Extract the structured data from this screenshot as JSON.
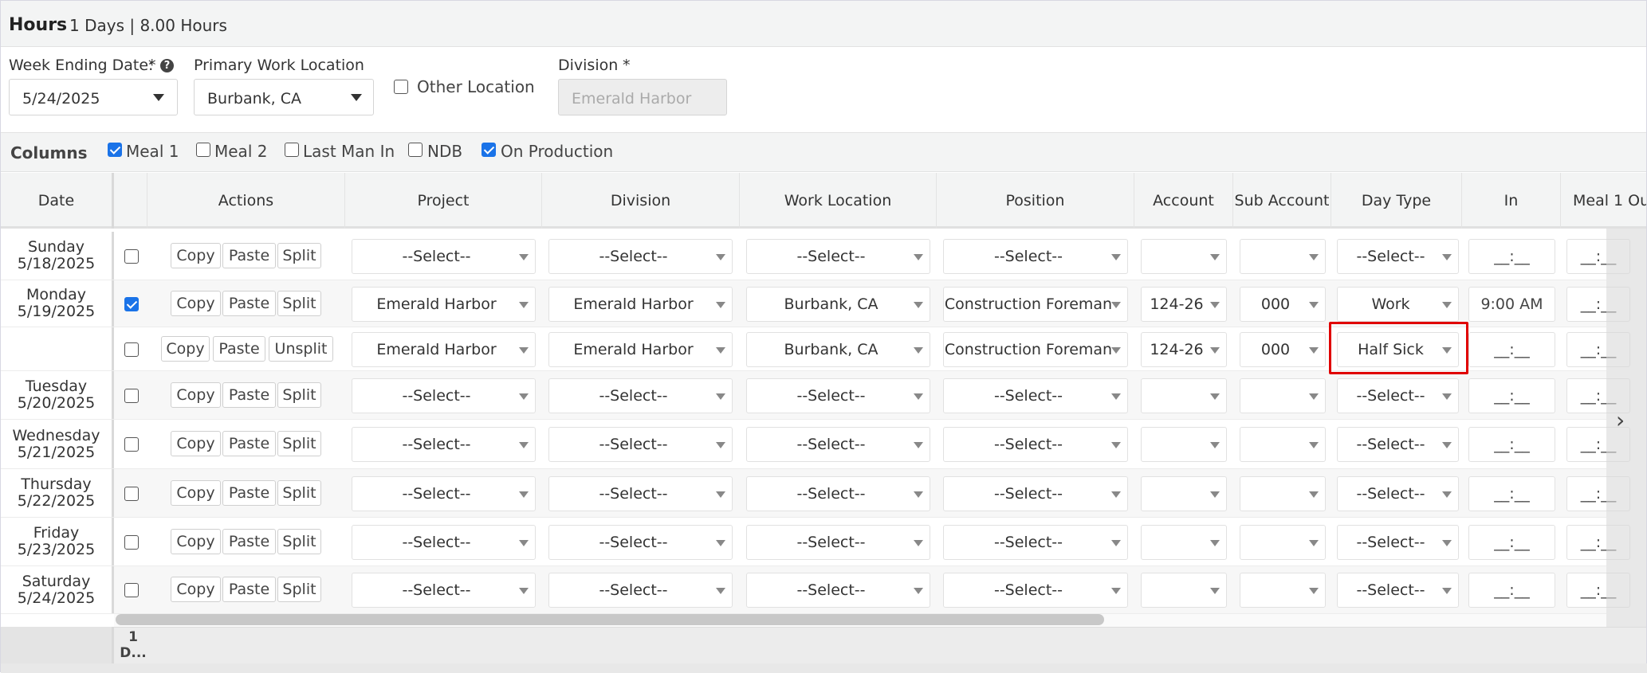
{
  "header": {
    "title": "Hours",
    "summary": "1 Days | 8.00 Hours"
  },
  "form": {
    "week_ending": {
      "label": "Week Ending Date:",
      "required": "*",
      "value": "5/24/2025"
    },
    "primary_location": {
      "label": "Primary Work Location",
      "value": "Burbank, CA"
    },
    "other_location": {
      "label": "Other Location",
      "checked": false
    },
    "division": {
      "label": "Division",
      "required": "*",
      "placeholder": "Emerald Harbor"
    }
  },
  "columns_bar": {
    "title": "Columns",
    "options": [
      {
        "label": "Meal 1",
        "checked": true
      },
      {
        "label": "Meal 2",
        "checked": false
      },
      {
        "label": "Last Man In",
        "checked": false
      },
      {
        "label": "NDB",
        "checked": false
      },
      {
        "label": "On Production",
        "checked": true
      }
    ]
  },
  "grid": {
    "headers": [
      "Date",
      "",
      "Actions",
      "Project",
      "Division",
      "Work Location",
      "Position",
      "Account",
      "Sub Account",
      "Day Type",
      "In",
      "Meal 1 Ou"
    ],
    "buttons": {
      "copy": "Copy",
      "paste": "Paste",
      "split": "Split",
      "unsplit": "Unsplit"
    },
    "rows": [
      {
        "day": "Sunday",
        "date": "5/18/2025",
        "checked": false,
        "project": "--Select--",
        "division": "--Select--",
        "location": "--Select--",
        "position": "--Select--",
        "account": "",
        "sub_account": "",
        "day_type": "--Select--",
        "in": "__:__",
        "meal1_out": "__:__"
      },
      {
        "day": "Monday",
        "date": "5/19/2025",
        "checked": true,
        "project": "Emerald Harbor",
        "division": "Emerald Harbor",
        "location": "Burbank, CA",
        "position": "Construction Foreman",
        "account": "124-26",
        "sub_account": "000",
        "day_type": "Work",
        "in": "9:00 AM",
        "meal1_out": "__:__"
      },
      {
        "day": "",
        "date": "",
        "checked": false,
        "project": "Emerald Harbor",
        "division": "Emerald Harbor",
        "location": "Burbank, CA",
        "position": "Construction Foreman",
        "account": "124-26",
        "sub_account": "000",
        "day_type": "Half Sick",
        "in": "__:__",
        "meal1_out": "__:__"
      },
      {
        "day": "Tuesday",
        "date": "5/20/2025",
        "checked": false,
        "project": "--Select--",
        "division": "--Select--",
        "location": "--Select--",
        "position": "--Select--",
        "account": "",
        "sub_account": "",
        "day_type": "--Select--",
        "in": "__:__",
        "meal1_out": "__:__"
      },
      {
        "day": "Wednesday",
        "date": "5/21/2025",
        "checked": false,
        "project": "--Select--",
        "division": "--Select--",
        "location": "--Select--",
        "position": "--Select--",
        "account": "",
        "sub_account": "",
        "day_type": "--Select--",
        "in": "__:__",
        "meal1_out": "__:__"
      },
      {
        "day": "Thursday",
        "date": "5/22/2025",
        "checked": false,
        "project": "--Select--",
        "division": "--Select--",
        "location": "--Select--",
        "position": "--Select--",
        "account": "",
        "sub_account": "",
        "day_type": "--Select--",
        "in": "__:__",
        "meal1_out": "__:__"
      },
      {
        "day": "Friday",
        "date": "5/23/2025",
        "checked": false,
        "project": "--Select--",
        "division": "--Select--",
        "location": "--Select--",
        "position": "--Select--",
        "account": "",
        "sub_account": "",
        "day_type": "--Select--",
        "in": "__:__",
        "meal1_out": "__:__"
      },
      {
        "day": "Saturday",
        "date": "5/24/2025",
        "checked": false,
        "project": "--Select--",
        "division": "--Select--",
        "location": "--Select--",
        "position": "--Select--",
        "account": "",
        "sub_account": "",
        "day_type": "--Select--",
        "in": "__:__",
        "meal1_out": "__:__"
      }
    ],
    "footer_count": "1 D..."
  },
  "colors": {
    "accent": "#1a73e8",
    "highlight": "#e00000"
  }
}
